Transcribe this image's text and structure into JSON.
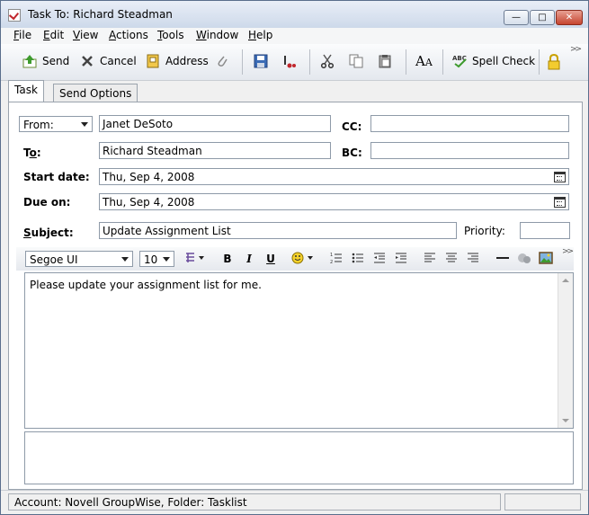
{
  "window": {
    "title": "Task To: Richard Steadman"
  },
  "menu": [
    {
      "pre": "",
      "u": "F",
      "post": "ile"
    },
    {
      "pre": "",
      "u": "E",
      "post": "dit"
    },
    {
      "pre": "",
      "u": "V",
      "post": "iew"
    },
    {
      "pre": "",
      "u": "A",
      "post": "ctions"
    },
    {
      "pre": "",
      "u": "T",
      "post": "ools"
    },
    {
      "pre": "",
      "u": "W",
      "post": "indow"
    },
    {
      "pre": "",
      "u": "H",
      "post": "elp"
    }
  ],
  "toolbar": {
    "send": "Send",
    "cancel": "Cancel",
    "address": "Address",
    "spell_check": "Spell Check"
  },
  "tabs": [
    "Task",
    "Send Options"
  ],
  "form": {
    "from_select": "From:",
    "from_value": "Janet DeSoto",
    "cc_label": "CC:",
    "to_label_pre": "T",
    "to_label_u": "o",
    "to_label_post": ":",
    "to_value": "Richard Steadman",
    "bc_label": "BC:",
    "start_label": "Start date:",
    "start_value": "Thu, Sep 4, 2008",
    "due_label": "Due on:",
    "due_value": "Thu, Sep 4, 2008",
    "subject_label_pre": "",
    "subject_label_u": "S",
    "subject_label_post": "ubject:",
    "subject_value": "Update Assignment List",
    "priority_label": "Priority:",
    "priority_value": ""
  },
  "format": {
    "font": "Segoe UI",
    "size": "10",
    "bold": "B",
    "italic": "I",
    "underline": "U"
  },
  "body": {
    "text": "Please update your assignment list for me."
  },
  "status": {
    "text": "Account: Novell GroupWise,  Folder: Tasklist"
  },
  "colors": {
    "close_button": "#c6452f",
    "title_bg": "#cdd9ea"
  }
}
